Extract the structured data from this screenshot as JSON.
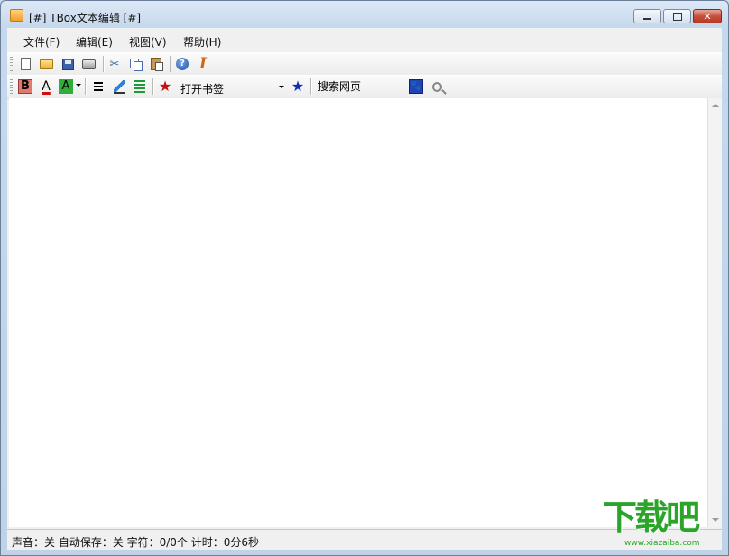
{
  "window": {
    "title": "[#] TBox文本编辑 [#]",
    "close_glyph": "✕"
  },
  "menu": {
    "items": [
      "文件(F)",
      "编辑(E)",
      "视图(V)",
      "帮助(H)"
    ]
  },
  "toolbar": {
    "icons": [
      "new-document-icon",
      "open-folder-icon",
      "save-icon",
      "print-icon",
      "cut-icon",
      "copy-icon",
      "paste-icon",
      "help-icon",
      "font-icon"
    ],
    "cut_glyph": "✂",
    "help_glyph": "?",
    "font_glyph": "I"
  },
  "format_bar": {
    "bold_label": "B",
    "font_color_label": "A",
    "highlight_label": "A",
    "bookmark_star_glyph": "★",
    "bookmark_select_value": "打开书签",
    "add_star_glyph": "★",
    "search_placeholder": "搜索网页",
    "paw_glyph": "🐾",
    "colors": {
      "bold_bg": "#e07a70",
      "font_color_underline": "#d01010",
      "highlight_bg": "#2fae3a",
      "bookmark_star": "#c01010",
      "add_star": "#1030b0"
    }
  },
  "editor": {
    "content": ""
  },
  "status": {
    "text": "声音：关  自动保存：关  字符：0/0个  计时：0分6秒"
  },
  "watermark": {
    "logo": "下载吧",
    "url": "www.xiazaiba.com"
  }
}
